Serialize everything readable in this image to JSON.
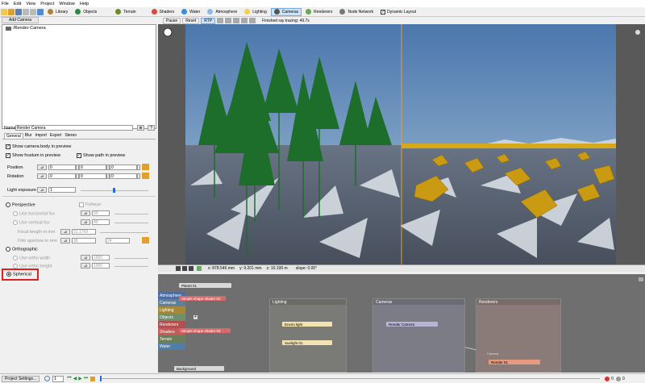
{
  "menu": [
    "File",
    "Edit",
    "View",
    "Project",
    "Window",
    "Help"
  ],
  "toolbar": {
    "library_label": "Library",
    "objects_label": "Objects",
    "terrain_label": "Terrain",
    "shaders_label": "Shaders",
    "water_label": "Water",
    "atmosphere_label": "Atmosphere",
    "lighting_label": "Lighting",
    "cameras_label": "Cameras",
    "renderers_label": "Renderers",
    "node_network_label": "Node Network",
    "dynamic_layout_label": "Dynamic Layout"
  },
  "left": {
    "add_camera_label": "Add Camera",
    "tree_item": "/Render Camera",
    "name_label": "Name",
    "name_value": "Render Camera",
    "tabs": [
      "General",
      "Blur",
      "Import",
      "Export",
      "Stereo"
    ],
    "show_body": "Show camera body in preview",
    "show_frustum": "Show frustum in preview",
    "show_path": "Show path in preview",
    "position_label": "Position",
    "position": [
      "0",
      "0",
      "0"
    ],
    "rotation_label": "Rotation",
    "rotation": [
      "0",
      "0",
      "0"
    ],
    "light_exposure_label": "Light exposure",
    "light_exposure": "1",
    "perspective_label": "Perspective",
    "fisheye_label": "Fisheye",
    "use_hfov": "Use horizontal fov",
    "hfov": "60",
    "use_vfov": "Use vertical fov",
    "vfov": "40",
    "focal_label": "Focal length in mm",
    "focal": "31.1769",
    "film_label": "Film aperture in mm",
    "film_w": "36",
    "film_h": "24",
    "ortho_label": "Orthographic",
    "use_ortho_w": "Use ortho width",
    "ortho_w": "1000",
    "use_ortho_h": "Use ortho height",
    "ortho_h": "1000",
    "spherical_label": "Spherical"
  },
  "viewport": {
    "pause": "Pause",
    "reset": "Reset",
    "rtp": "RTP",
    "status": "Finished ray tracing: 49.7s",
    "coord_x": "x: 878.546 mm",
    "coord_y": "y: 9.201 mm",
    "coord_z": "z: 10.100 m",
    "slope": "slope: 0.00°"
  },
  "graph": {
    "categories": [
      "Atmosphere",
      "Cameras",
      "Lighting",
      "Objects",
      "Renderers",
      "Shaders",
      "Terrain",
      "Water"
    ],
    "planet": "Planet 01",
    "shader1": "Simple shape shader 02",
    "shader2": "Simple shape shader 03",
    "background": "Background",
    "group_lighting": "Lighting",
    "group_cameras": "Cameras",
    "group_renderers": "Renderers",
    "enviro": "Enviro light",
    "sunlight": "Sunlight 01",
    "render_camera": "Render Camera",
    "camera_port": "Camera",
    "render01": "Render 01"
  },
  "bottom": {
    "project_settings": "Project Settings...",
    "frame": "1",
    "counter_left": "0",
    "counter_right": "0"
  },
  "colors": {
    "accent": "#1e6fd9",
    "highlight": "#e02020",
    "sky_top": "#4d7ab0",
    "ground": "#505b6a"
  }
}
